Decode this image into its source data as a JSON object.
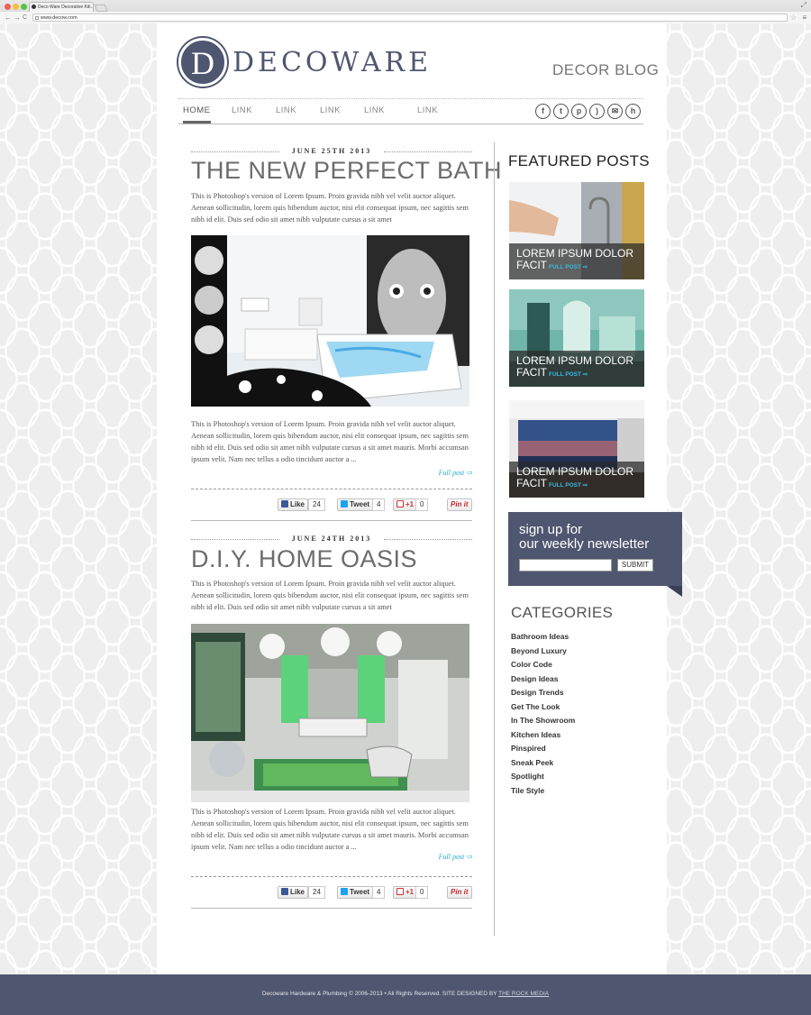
{
  "browser": {
    "tab_title": "Deco Ware Decorative Kit...",
    "tab_close": "×",
    "url": "www.decow.com",
    "back": "←",
    "forward": "→",
    "reload": "C"
  },
  "header": {
    "logo_letter": "D",
    "logo_text": "DECOWARE",
    "blog_title": "DECOR BLOG"
  },
  "nav": {
    "items": [
      "HOME",
      "LINK",
      "LINK",
      "LINK",
      "LINK",
      "LINK"
    ],
    "social_icons": [
      "facebook-icon",
      "twitter-icon",
      "pinterest-icon",
      "rss-icon",
      "email-icon",
      "houzz-icon"
    ]
  },
  "posts": [
    {
      "date": "JUNE 25TH 2013",
      "title": "THE NEW PERFECT BATH",
      "intro": "This is Photoshop's version  of Lorem Ipsum. Proin gravida nibh vel velit auctor aliquet. Aenean sollicitudin, lorem quis bibendum auctor, nisi elit consequat ipsum, nec sagittis sem nibh id elit. Duis sed odio sit amet nibh vulputate cursus a sit amet",
      "body": "This is Photoshop's version  of Lorem Ipsum. Proin gravida nibh vel velit auctor aliquet. Aenean sollicitudin, lorem quis bibendum auctor, nisi elit consequat ipsum, nec sagittis sem nibh id elit. Duis sed odio sit amet nibh vulputate cursus a sit amet mauris. Morbi accumsan ipsum velit. Nam nec tellus a odio tincidunt auctor a ...",
      "full_post": "Full post ⇨",
      "like_label": "Like",
      "like_count": "24",
      "tweet_label": "Tweet",
      "tweet_count": "4",
      "plus_label": "+1",
      "plus_count": "0",
      "pin_label": "Pin it"
    },
    {
      "date": "JUNE 24TH 2013",
      "title": "D.I.Y. HOME OASIS",
      "intro": "This is Photoshop's version  of Lorem Ipsum. Proin gravida nibh vel velit auctor aliquet. Aenean sollicitudin, lorem quis bibendum auctor, nisi elit consequat ipsum, nec sagittis sem nibh id elit. Duis sed odio sit amet nibh vulputate cursus a sit amet",
      "body": "This is Photoshop's version  of Lorem Ipsum. Proin gravida nibh vel velit auctor aliquet. Aenean sollicitudin, lorem quis bibendum auctor, nisi elit consequat ipsum, nec sagittis sem nibh id elit. Duis sed odio sit amet nibh vulputate cursus a sit amet mauris. Morbi accumsan ipsum velit. Nam nec tellus a odio tincidunt auctor a ...",
      "full_post": "Full post ⇨",
      "like_label": "Like",
      "like_count": "24",
      "tweet_label": "Tweet",
      "tweet_count": "4",
      "plus_label": "+1",
      "plus_count": "0",
      "pin_label": "Pin it"
    }
  ],
  "sidebar": {
    "featured_title": "FEATURED POSTS",
    "featured": [
      {
        "line1": "LOREM IPSUM DOLOR",
        "line2": "FACIT",
        "link": "FULL POST ⇨"
      },
      {
        "line1": "LOREM IPSUM DOLOR",
        "line2": "FACIT",
        "link": "FULL POST ⇨"
      },
      {
        "line1": "LOREM IPSUM DOLOR",
        "line2": "FACIT",
        "link": "FULL POST ⇨"
      }
    ],
    "newsletter": {
      "line1": "sign up for",
      "line2": "our weekly newsletter",
      "submit": "SUBMIT",
      "email_value": ""
    },
    "categories_title": "CATEGORIES",
    "categories": [
      "Bathroom Ideas",
      "Beyond Luxury",
      "Color Code",
      "Design Ideas",
      "Design Trends",
      "Get The Look",
      "In The Showroom",
      "Kitchen Ideas",
      "Pinspired",
      "Sneak Peek",
      "Spotlight",
      "Tile Style"
    ]
  },
  "footer": {
    "text": "Decoware Hardware & Plumbing © 2006-2013 • All Rights Reserved. SITE DESIGNED BY ",
    "link": "THE ROCK MEDIA"
  },
  "colors": {
    "brand": "#4f5670",
    "accent_link": "#29a9c9"
  }
}
